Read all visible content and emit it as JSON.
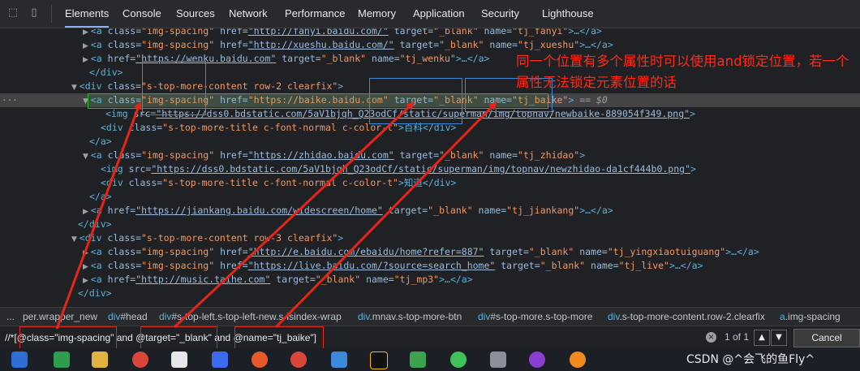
{
  "tabs": [
    "Elements",
    "Console",
    "Sources",
    "Network",
    "Performance",
    "Memory",
    "Application",
    "Security",
    "Lighthouse"
  ],
  "tree": [
    {
      "tag_open": "<a ",
      "a1": "class=",
      "v1": "\"img-spacing\"",
      "a2": " href=",
      "l": "\"http://fanyi.baidu.com/\"",
      "a3": " target=",
      "v3": "\"_blank\"",
      "a4": " name=",
      "v4": "\"tj_fanyi\"",
      "t": ">…",
      "tag_close": "</a>"
    },
    {
      "tag_open": "<a ",
      "a1": "class=",
      "v1": "\"img-spacing\"",
      "a2": " href=",
      "l": "\"http://xueshu.baidu.com/\"",
      "a3": " target=",
      "v3": "\"_blank\"",
      "a4": " name=",
      "v4": "\"tj_xueshu\"",
      "t": ">…",
      "tag_close": "</a>"
    },
    {
      "tag_open": "<a ",
      "a2": "href=",
      "l": "\"https://wenku.baidu.com\"",
      "a3": " target=",
      "v3": "\"_blank\"",
      "a4": " name=",
      "v4": "\"tj_wenku\"",
      "t": ">…",
      "tag_close": "</a>"
    },
    {
      "tag_close": "</div>"
    },
    {
      "tag_open": "<div ",
      "a1": "class=",
      "v1": "\"s-top-more-content row-2 clearfix\"",
      "t": ">"
    },
    {
      "tag_open": "<a ",
      "a1": "class=",
      "v1": "\"img-spacing\"",
      "a2": " href=",
      "v2": "\"https://baike.baidu.com\"",
      "a3": " target=",
      "v3": "\"_blank\"",
      "a4": " name=",
      "v4": "\"tj_baike\"",
      "t": ">",
      "eq": " == $0"
    },
    {
      "tag_open": "<img ",
      "a2": "src=",
      "l": "\"https://dss0.bdstatic.com/5aV1bjqh_Q23odCf/static/superman/img/topnav/newbaike-889054f349.png\"",
      "t": ">"
    },
    {
      "tag_open": "<div ",
      "a1": "class=",
      "v1": "\"s-top-more-title c-font-normal c-color-t\"",
      "t": ">百科",
      "tag_close": "</div>"
    },
    {
      "tag_close": "</a>"
    },
    {
      "tag_open": "<a ",
      "a1": "class=",
      "v1": "\"img-spacing\"",
      "a2": " href=",
      "l": "\"https://zhidao.baidu.com\"",
      "a3": " target=",
      "v3": "\"_blank\"",
      "a4": " name=",
      "v4": "\"tj_zhidao\"",
      "t": ">"
    },
    {
      "tag_open": "<img ",
      "a2": "src=",
      "l": "\"https://dss0.bdstatic.com/5aV1bjqh_Q23odCf/static/superman/img/topnav/newzhidao-da1cf444b0.png\"",
      "t": ">"
    },
    {
      "tag_open": "<div ",
      "a1": "class=",
      "v1": "\"s-top-more-title c-font-normal c-color-t\"",
      "t": ">知道",
      "tag_close": "</div>"
    },
    {
      "tag_close": "</a>"
    },
    {
      "tag_open": "<a ",
      "a2": "href=",
      "l": "\"https://jiankang.baidu.com/widescreen/home\"",
      "a3": " target=",
      "v3": "\"_blank\"",
      "a4": " name=",
      "v4": "\"tj_jiankang\"",
      "t": ">…",
      "tag_close": "</a>"
    },
    {
      "tag_close": "</div>"
    },
    {
      "tag_open": "<div ",
      "a1": "class=",
      "v1": "\"s-top-more-content row-3 clearfix\"",
      "t": ">"
    },
    {
      "tag_open": "<a ",
      "a1": "class=",
      "v1": "\"img-spacing\"",
      "a2": " href=",
      "l": "\"http://e.baidu.com/ebaidu/home?refer=887\"",
      "a3": " target=",
      "v3": "\"_blank\"",
      "a4": " name=",
      "v4": "\"tj_yingxiaotuiguang\"",
      "t": ">…",
      "tag_close": "</a>"
    },
    {
      "tag_open": "<a ",
      "a1": "class=",
      "v1": "\"img-spacing\"",
      "a2": " href=",
      "l": "\"https://live.baidu.com/?source=search_home\"",
      "a3": " target=",
      "v3": "\"_blank\"",
      "a4": " name=",
      "v4": "\"tj_live\"",
      "t": ">…",
      "tag_close": "</a>"
    },
    {
      "tag_open": "<a ",
      "a2": "href=",
      "l": "\"http://music.taihe.com\"",
      "a3": " target=",
      "v3": "\"_blank\"",
      "a4": " name=",
      "v4": "\"tj_mp3\"",
      "t": ">…",
      "tag_close": "</a>"
    },
    {
      "tag_close": "</div>"
    }
  ],
  "annotation": "同一个位置有多个属性时可以使用and锁定位置，若一个属性无法锁定元素位置的话",
  "breadcrumbs": [
    {
      "text": "...",
      "kind": "plain"
    },
    {
      "text": "per.wrapper_new",
      "kind": "plain"
    },
    {
      "text": "div",
      "suffix": "#head",
      "kind": "tag"
    },
    {
      "text": "div",
      "suffix": "#s-top-left.s-top-left-new.s-isindex-wrap",
      "kind": "tag"
    },
    {
      "text": "div",
      "suffix": ".mnav.s-top-more-btn",
      "kind": "tag"
    },
    {
      "text": "div",
      "suffix": "#s-top-more.s-top-more",
      "kind": "tag"
    },
    {
      "text": "div",
      "suffix": ".s-top-more-content.row-2.clearfix",
      "kind": "tag"
    },
    {
      "text": "a",
      "suffix": ".img-spacing",
      "kind": "tag"
    }
  ],
  "search": {
    "value": "//*[@class=\"img-spacing\" and @target=\"_blank\" and @name=\"tj_baike\"]",
    "count": "1 of 1",
    "cancel": "Cancel"
  },
  "watermark": "CSDN @^会飞的鱼Fly^",
  "colors": {
    "accent": "#8ab4f8",
    "annotation_red": "#ff2a1a",
    "highlight_green": "#19c319",
    "box_blue": "#3b8bd9"
  }
}
